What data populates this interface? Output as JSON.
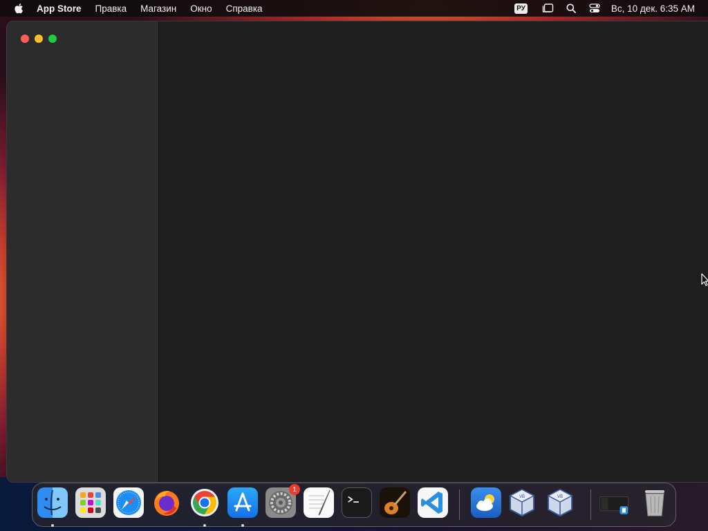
{
  "menubar": {
    "app_name": "App Store",
    "menus": [
      "Правка",
      "Магазин",
      "Окно",
      "Справка"
    ],
    "keyboard_layout": "РУ",
    "clock": "Вс, 10 дек.  6:35 AM",
    "status_icons": [
      "stage-manager-icon",
      "search-icon",
      "control-center-icon"
    ]
  },
  "window": {
    "app": "App Store",
    "content": ""
  },
  "dock": {
    "items": [
      {
        "name": "finder",
        "running": true
      },
      {
        "name": "launchpad",
        "running": false
      },
      {
        "name": "safari",
        "running": false
      },
      {
        "name": "firefox",
        "running": false
      },
      {
        "name": "chrome",
        "running": true
      },
      {
        "name": "app-store",
        "running": true
      },
      {
        "name": "system-settings",
        "running": false,
        "badge": "1"
      },
      {
        "name": "textedit",
        "running": false
      },
      {
        "name": "terminal",
        "running": false
      },
      {
        "name": "garageband",
        "running": false
      },
      {
        "name": "vscode",
        "running": false
      },
      {
        "name": "weather",
        "running": false
      },
      {
        "name": "virtualbox",
        "running": false
      },
      {
        "name": "virtualbox-2",
        "running": false
      },
      {
        "name": "screenshot-window",
        "running": false
      },
      {
        "name": "trash",
        "running": false
      }
    ],
    "colors": {
      "finder": "#2f8cf0",
      "safari": "#1e8ef5",
      "chrome-red": "#ea4335",
      "chrome-yellow": "#fbbc04",
      "chrome-green": "#34a853",
      "app-store": "#1a8cf5",
      "vscode": "#2a8fe0",
      "weather": "#2a7fe0",
      "badge": "#f03a2e"
    }
  }
}
